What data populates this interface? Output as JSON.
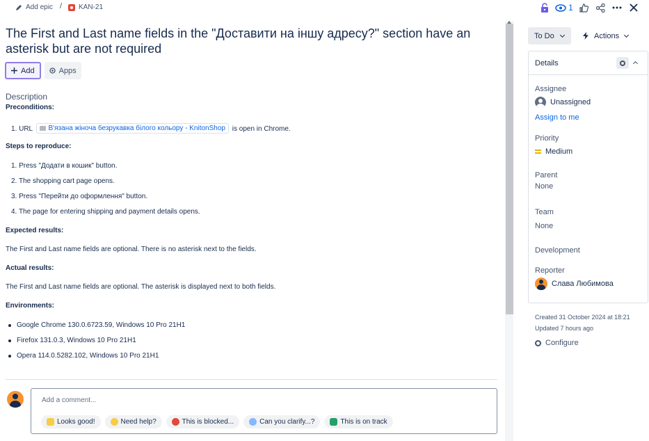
{
  "breadcrumb": {
    "epic_label": "Add epic",
    "separator": "/",
    "issue_key": "KAN-21"
  },
  "top_actions": {
    "watch_count": "1",
    "icons": [
      "lock-icon",
      "eye-icon",
      "thumbs-up-icon",
      "share-icon",
      "more-icon",
      "close-icon"
    ]
  },
  "issue": {
    "title": "The First and Last name fields in the \"Доставити на іншу адресу?\" section have an asterisk but are not required",
    "add_label": "Add",
    "apps_label": "Apps"
  },
  "description": {
    "label": "Description",
    "preconditions_heading": "Preconditions:",
    "precondition": {
      "prefix": "1. URL",
      "link_text": "В'язана жіноча безрукавка білого кольору - KnitonShop",
      "suffix": "is open in Chrome."
    },
    "steps_heading": "Steps to reproduce:",
    "steps": [
      "1. Press \"Додати в кошик\" button.",
      "2. The shopping cart page opens.",
      "3. Press \"Перейти до оформлення\" button.",
      "4. The page for entering shipping and payment details opens."
    ],
    "expected_heading": "Expected results:",
    "expected_text": "The First and Last name fields are optional. There is no asterisk next to the fields.",
    "actual_heading": "Actual results:",
    "actual_text": "The First and Last name fields are optional. The asterisk is displayed next to both fields.",
    "env_heading": "Environments:",
    "environments": [
      "Google Chrome 130.0.6723.59, Windows 10 Pro 21H1",
      "Firefox 131.0.3, Windows 10 Pro 21H1",
      "Opera 114.0.5282.102, Windows 10 Pro 21H1"
    ]
  },
  "comment": {
    "placeholder": "Add a comment...",
    "suggestions": [
      "Looks good!",
      "Need help?",
      "This is blocked...",
      "Can you clarify...?",
      "This is on track"
    ]
  },
  "sidebar": {
    "status_label": "To Do",
    "actions_label": "Actions",
    "details_title": "Details",
    "assignee_label": "Assignee",
    "assignee_value": "Unassigned",
    "assign_to_me": "Assign to me",
    "priority_label": "Priority",
    "priority_value": "Medium",
    "parent_label": "Parent",
    "parent_value": "None",
    "team_label": "Team",
    "team_value": "None",
    "development_label": "Development",
    "reporter_label": "Reporter",
    "reporter_value": "Слава Любимова",
    "created": "Created 31 October 2024 at 18:21",
    "updated": "Updated 7 hours ago",
    "configure_label": "Configure"
  },
  "colors": {
    "accent": "#0c66e4",
    "bug": "#e2483d",
    "priority_medium": "#e2b203",
    "avatar_orange": "#f79232"
  }
}
